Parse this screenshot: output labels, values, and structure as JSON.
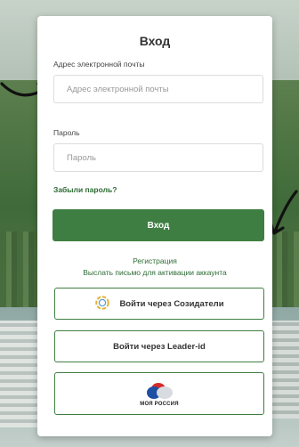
{
  "login": {
    "title": "Вход",
    "email_label": "Адрес электронной почты",
    "email_placeholder": "Адрес электронной почты",
    "password_label": "Пароль",
    "password_placeholder": "Пароль",
    "forgot_password": "Забыли пароль?",
    "submit_label": "Вход",
    "register_link": "Регистрация",
    "resend_activation_link": "Выслать письмо для активации аккаунта",
    "sozidateli_button": "Войти через Созидатели",
    "leader_id_button": "Войти через Leader-id",
    "moya_rossiya_label": "МОЯ РОССИЯ"
  },
  "colors": {
    "primary": "#3f7e42",
    "link": "#2d6b34",
    "card": "#ffffff"
  },
  "icons": [
    "sozidateli-logo-icon",
    "moya-rossiya-logo",
    "annotation-arrow-icon"
  ]
}
